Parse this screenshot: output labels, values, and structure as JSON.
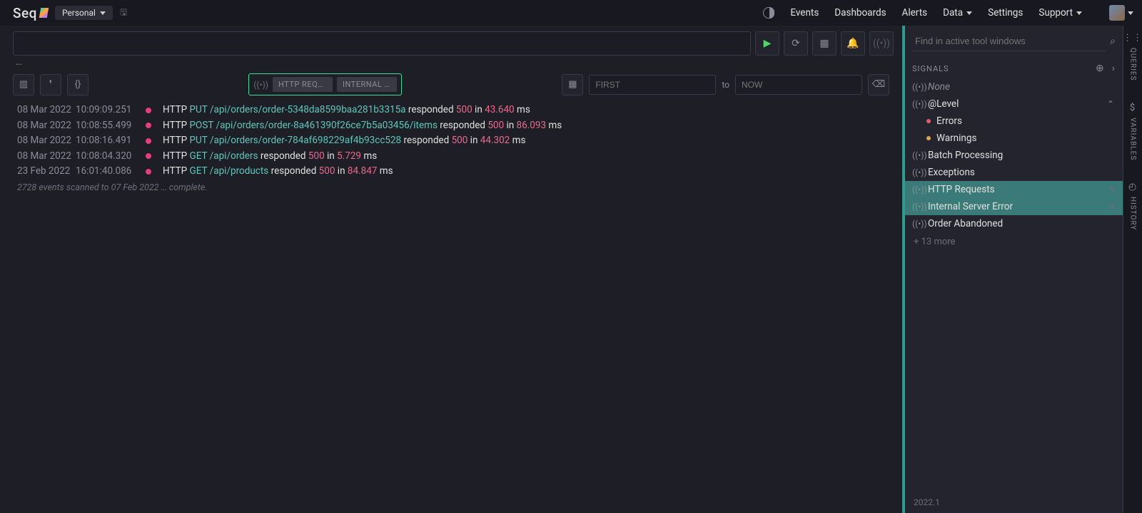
{
  "brand": "Seq",
  "workspace": "Personal",
  "nav": {
    "events": "Events",
    "dashboards": "Dashboards",
    "alerts": "Alerts",
    "data": "Data",
    "settings": "Settings",
    "support": "Support"
  },
  "query": {
    "value": "",
    "ellipsis": "…"
  },
  "filter_chips": {
    "chip1": "HTTP REQU…",
    "chip2": "INTERNAL S…"
  },
  "date": {
    "from_placeholder": "FIRST",
    "to_label": "to",
    "to_placeholder": "NOW"
  },
  "events": [
    {
      "date": "08 Mar 2022",
      "time": "10:09:09.251",
      "pre": "HTTP ",
      "method": "PUT",
      "path": " /api/orders/order-5348da8599baa281b3315a",
      "mid": " responded ",
      "status": "500",
      "mid2": " in ",
      "elapsed": "43.640",
      "suffix": " ms"
    },
    {
      "date": "08 Mar 2022",
      "time": "10:08:55.499",
      "pre": "HTTP ",
      "method": "POST",
      "path": " /api/orders/order-8a461390f26ce7b5a03456/items",
      "mid": " responded ",
      "status": "500",
      "mid2": " in ",
      "elapsed": "86.093",
      "suffix": " ms"
    },
    {
      "date": "08 Mar 2022",
      "time": "10:08:16.491",
      "pre": "HTTP ",
      "method": "PUT",
      "path": " /api/orders/order-784af698229af4b93cc528",
      "mid": " responded ",
      "status": "500",
      "mid2": " in ",
      "elapsed": "44.302",
      "suffix": " ms"
    },
    {
      "date": "08 Mar 2022",
      "time": "10:08:04.320",
      "pre": "HTTP ",
      "method": "GET",
      "path": " /api/orders",
      "mid": " responded ",
      "status": "500",
      "mid2": " in ",
      "elapsed": "5.729",
      "suffix": " ms"
    },
    {
      "date": "23 Feb 2022",
      "time": "16:01:40.086",
      "pre": "HTTP ",
      "method": "GET",
      "path": " /api/products",
      "mid": " responded ",
      "status": "500",
      "mid2": " in ",
      "elapsed": "84.847",
      "suffix": " ms"
    }
  ],
  "scan_note": "2728 events scanned to 07 Feb 2022 … complete.",
  "side_search_placeholder": "Find in active tool windows",
  "signals_header": "SIGNALS",
  "signals": [
    {
      "label": "None",
      "italic": true,
      "glyph": "signal"
    },
    {
      "label": "@Level",
      "glyph": "signal",
      "expand": true
    },
    {
      "label": "Errors",
      "indent": true,
      "dot": "err"
    },
    {
      "label": "Warnings",
      "indent": true,
      "dot": "warn"
    },
    {
      "label": "Batch Processing",
      "glyph": "signal"
    },
    {
      "label": "Exceptions",
      "glyph": "signal"
    },
    {
      "label": "HTTP Requests",
      "glyph": "signal",
      "selected": true
    },
    {
      "label": "Internal Server Error",
      "glyph": "signal",
      "selected": true
    },
    {
      "label": "Order Abandoned",
      "glyph": "signal"
    }
  ],
  "signals_more": "+ 13 more",
  "version": "2022.1",
  "rail": {
    "queries": "QUERIES",
    "variables": "VARIABLES",
    "history": "HISTORY"
  }
}
